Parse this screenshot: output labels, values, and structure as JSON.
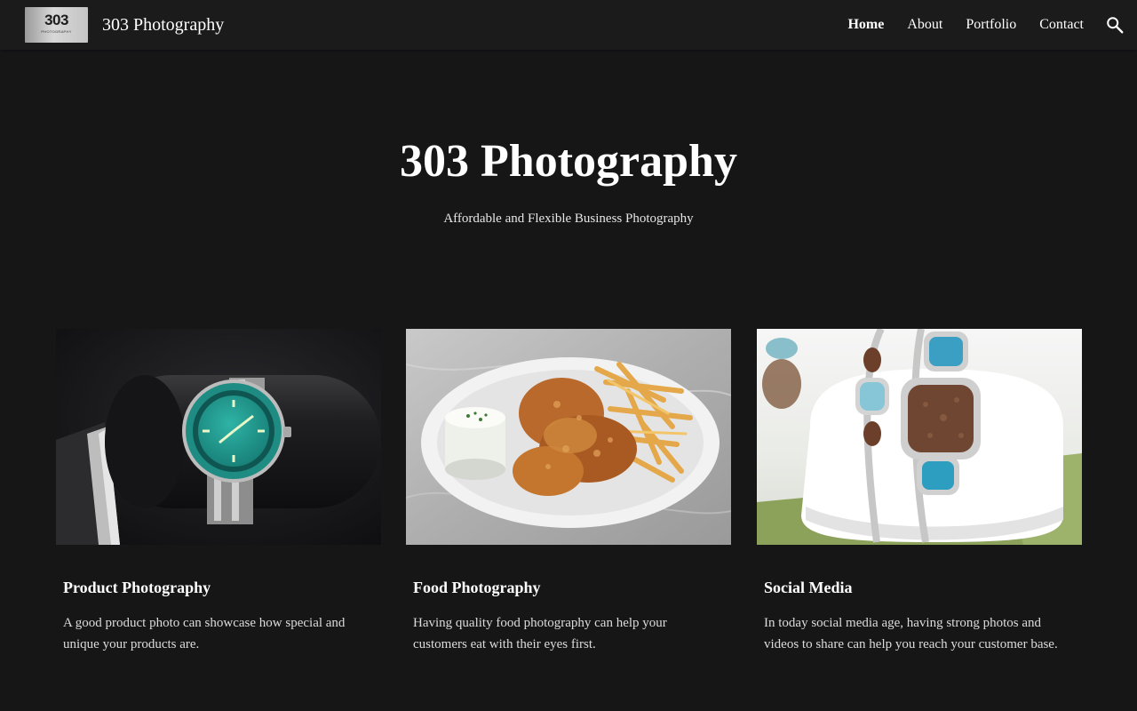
{
  "header": {
    "logo": {
      "mark": "303",
      "sub": "PHOTOGRAPHY"
    },
    "site_title": "303 Photography",
    "nav": [
      {
        "label": "Home",
        "active": true
      },
      {
        "label": "About",
        "active": false
      },
      {
        "label": "Portfolio",
        "active": false
      },
      {
        "label": "Contact",
        "active": false
      }
    ],
    "search_icon": "search-icon"
  },
  "hero": {
    "title": "303 Photography",
    "subtitle": "Affordable and Flexible Business Photography"
  },
  "cards": [
    {
      "image": "watch-photo",
      "title": "Product Photography",
      "text": "A good product photo can showcase how special and unique your products are."
    },
    {
      "image": "food-photo",
      "title": "Food Photography",
      "text": "Having quality food photography can help your customers eat with their eyes first."
    },
    {
      "image": "jewelry-photo",
      "title": "Social Media",
      "text": "In today social media age, having strong photos and videos to share can help you reach your customer base."
    }
  ],
  "colors": {
    "background": "#161617",
    "header": "#1b1b1c",
    "text": "#ffffff",
    "muted_text": "#dcdcdc"
  }
}
